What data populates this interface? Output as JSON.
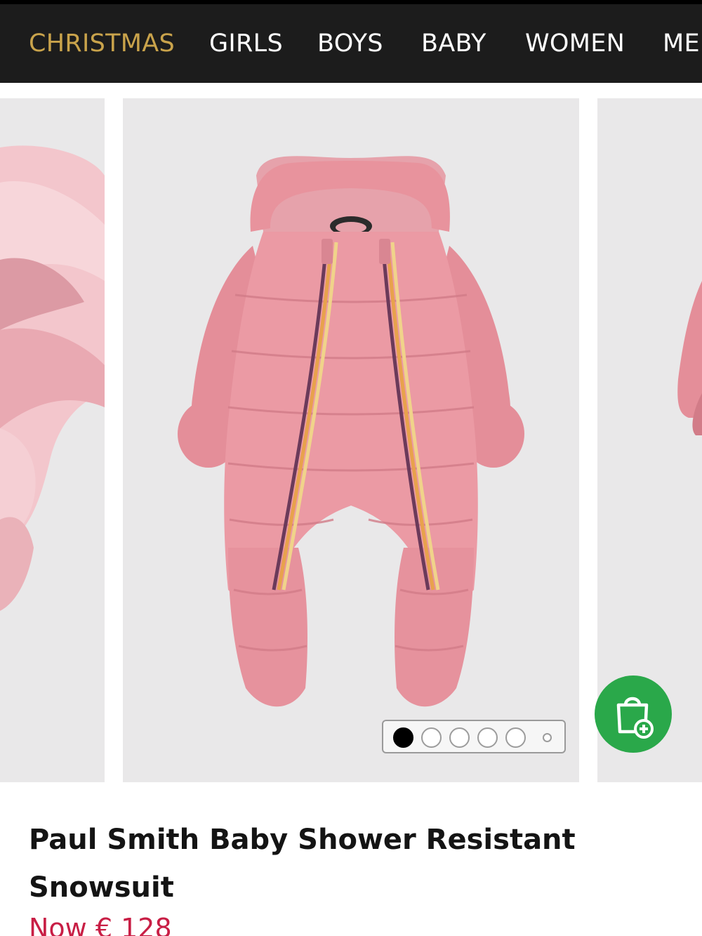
{
  "nav": {
    "items": [
      {
        "label": "CHRISTMAS",
        "active": true
      },
      {
        "label": "GIRLS"
      },
      {
        "label": "BOYS"
      },
      {
        "label": "BABY"
      },
      {
        "label": "WOMEN"
      },
      {
        "label": "ME"
      }
    ],
    "active_color": "#c9a34b",
    "background": "#1c1c1c"
  },
  "gallery": {
    "image_count": 6,
    "current_index": 0,
    "product_color": "#e79aa3",
    "stripe_colors": [
      "#6b3a5a",
      "#e8a24c",
      "#f0d38a"
    ]
  },
  "actions": {
    "add_to_bag_icon": "shopping-bag-plus-icon",
    "add_to_bag_color": "#2aa84a"
  },
  "product": {
    "title": "Paul Smith Baby Shower Resistant Snowsuit",
    "price": "Now € 128",
    "price_color": "#c81e45"
  }
}
